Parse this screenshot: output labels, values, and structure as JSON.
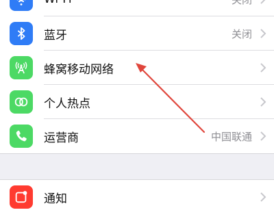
{
  "settings": {
    "rows": [
      {
        "label": "Wi-Fi",
        "value": "关闭",
        "icon": "wifi-icon",
        "color": "#2f7cf6"
      },
      {
        "label": "蓝牙",
        "value": "关闭",
        "icon": "bluetooth-icon",
        "color": "#2f7cf6"
      },
      {
        "label": "蜂窝移动网络",
        "value": "",
        "icon": "cellular-icon",
        "color": "#4cd964"
      },
      {
        "label": "个人热点",
        "value": "",
        "icon": "hotspot-icon",
        "color": "#4cd964"
      },
      {
        "label": "运营商",
        "value": "中国联通",
        "icon": "phone-icon",
        "color": "#4cd964"
      }
    ],
    "notifications": {
      "label": "通知",
      "icon": "notifications-icon",
      "color": "#ff3b30"
    }
  },
  "annotation": {
    "color": "#e0463c"
  }
}
